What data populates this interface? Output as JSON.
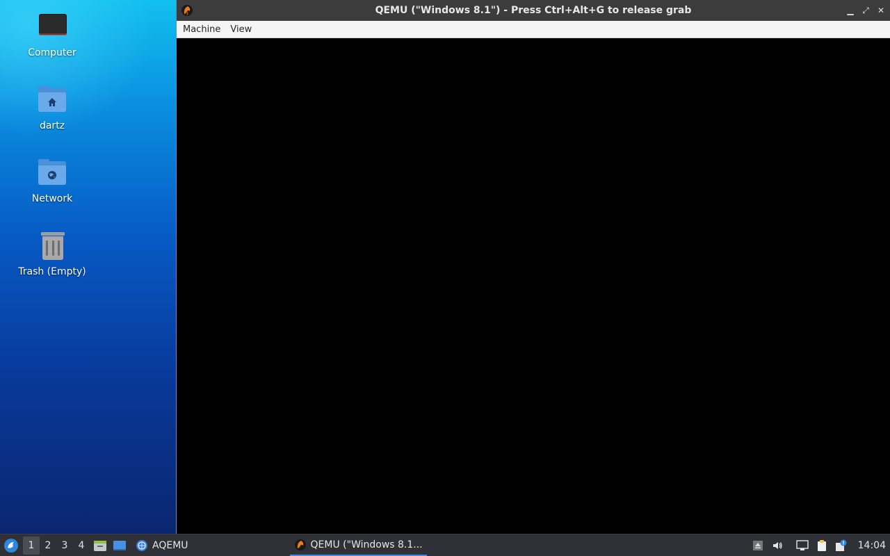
{
  "desktop": {
    "icons": [
      {
        "label": "Computer",
        "icon": "computer-icon"
      },
      {
        "label": "dartz",
        "icon": "home-folder-icon"
      },
      {
        "label": "Network",
        "icon": "network-folder-icon"
      },
      {
        "label": "Trash (Empty)",
        "icon": "trash-icon"
      }
    ]
  },
  "window": {
    "title": "QEMU (\"Windows 8.1\") - Press Ctrl+Alt+G to release grab",
    "app_icon": "qemu-icon",
    "controls": {
      "minimize": "▁",
      "maximize": "⤢",
      "close": "✕"
    },
    "menu": [
      "Machine",
      "View"
    ]
  },
  "taskbar": {
    "workspaces": [
      "1",
      "2",
      "3",
      "4"
    ],
    "active_workspace": "1",
    "tasks": [
      {
        "label": "AQEMU",
        "icon": "aqemu-icon"
      },
      {
        "label": "QEMU (\"Windows 8.1...",
        "icon": "qemu-icon",
        "active": true
      }
    ],
    "tray": [
      "eject-icon",
      "volume-icon",
      "network-icon",
      "clipboard-icon",
      "notification-icon"
    ],
    "clock": "14:04"
  },
  "colors": {
    "accent": "#3b8ee8",
    "titlebar": "#3c3c3c",
    "taskbar": "#2f3136"
  }
}
